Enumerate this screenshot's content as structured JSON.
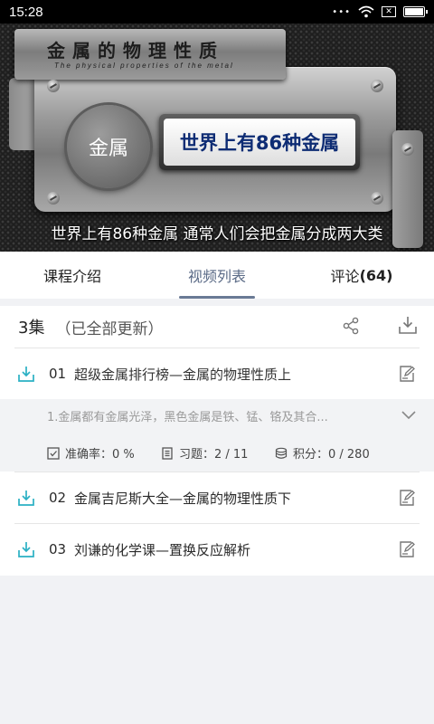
{
  "status_bar": {
    "time": "15:28",
    "sim_icon": "✕"
  },
  "video": {
    "title_cn": "金属的物理性质",
    "title_en": "The physical properties of the metal",
    "badge": "金属",
    "headline": "世界上有86种金属",
    "subtitle": "世界上有86种金属 通常人们会把金属分成两大类"
  },
  "tabs": [
    {
      "label": "课程介绍",
      "count": ""
    },
    {
      "label": "视频列表",
      "count": ""
    },
    {
      "label": "评论",
      "count": "(64)"
    }
  ],
  "episodes": {
    "count_label": "3集",
    "status": "（已全部更新）",
    "items": [
      {
        "num": "01",
        "title": "超级金属排行榜—金属的物理性质上"
      },
      {
        "num": "02",
        "title": "金属吉尼斯大全—金属的物理性质下"
      },
      {
        "num": "03",
        "title": "刘谦的化学课—置换反应解析"
      }
    ],
    "detail": {
      "description": "1.金属都有金属光泽，黑色金属是铁、锰、铬及其合...",
      "accuracy": "准确率：0 %",
      "exercises": "习题：2 / 11",
      "points": "积分：0 / 280"
    }
  },
  "colors": {
    "accent": "#2ab0c4",
    "tab_active": "#5a6a86"
  }
}
